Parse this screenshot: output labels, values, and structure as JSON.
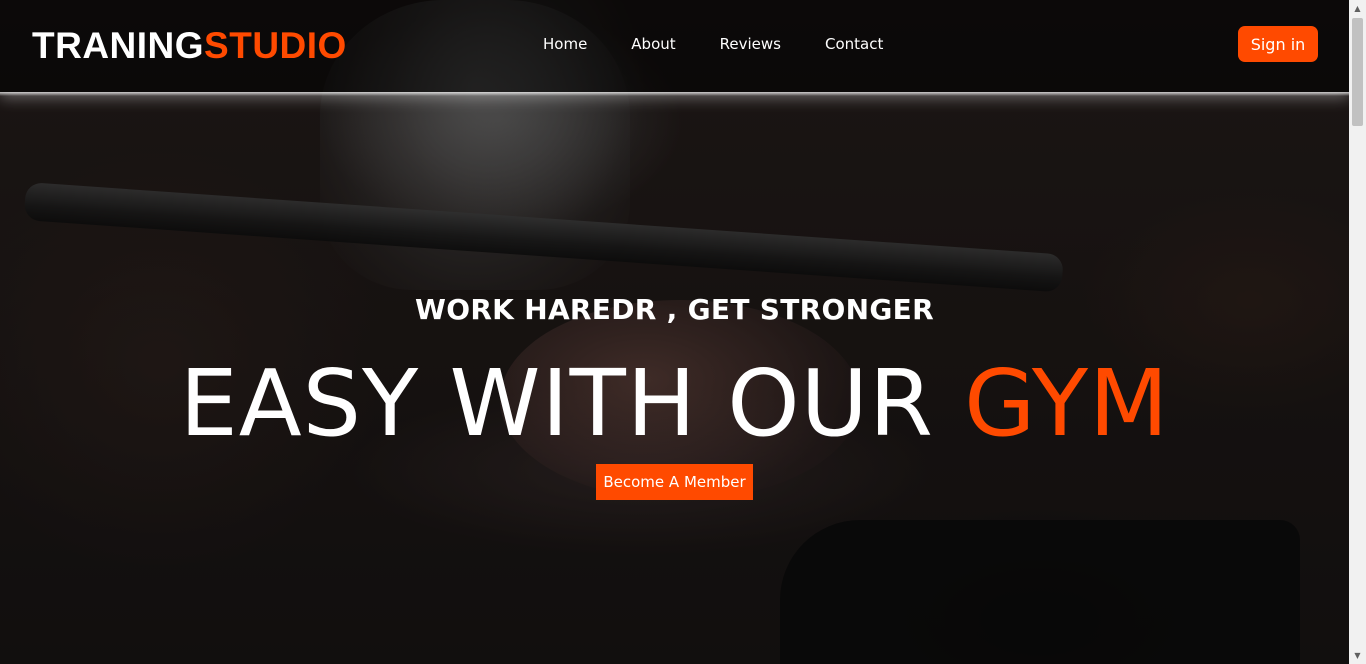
{
  "header": {
    "logo_main": "TRANING",
    "logo_accent": "STUDIO",
    "nav": [
      {
        "label": "Home"
      },
      {
        "label": "About"
      },
      {
        "label": "Reviews"
      },
      {
        "label": "Contact"
      }
    ],
    "signin_label": "Sign in"
  },
  "hero": {
    "subtitle": "WORK HAREDR , GET STRONGER",
    "headline_main": "EASY WITH OUR ",
    "headline_accent": "GYM",
    "cta_label": "Become A Member"
  },
  "colors": {
    "accent": "#ff4a00",
    "text": "#ffffff"
  },
  "scrollbar": {
    "up_icon": "triangle-up",
    "down_icon": "triangle-down"
  }
}
